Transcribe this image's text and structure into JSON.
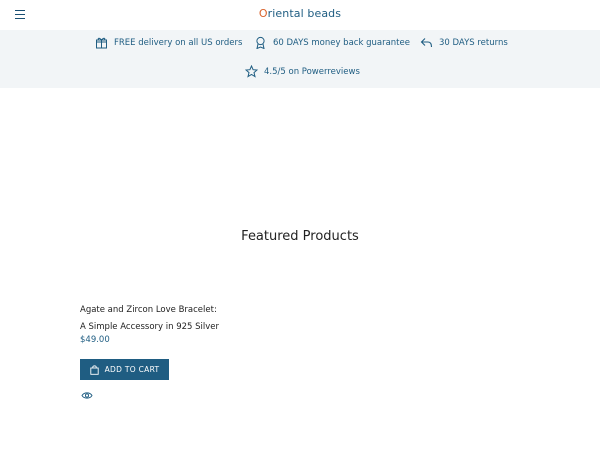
{
  "header": {
    "logo_first": "O",
    "logo_rest": "riental beads",
    "menu_icon": "hamburger-menu-icon"
  },
  "benefits": [
    {
      "icon": "gift-box-icon",
      "text": "FREE delivery on all US orders"
    },
    {
      "icon": "award-ribbon-icon",
      "text": "60 DAYS money back guarantee"
    },
    {
      "icon": "return-arrow-icon",
      "text": "30 DAYS returns"
    },
    {
      "icon": "star-icon",
      "text": "4.5/5 on Powerreviews"
    }
  ],
  "featured": {
    "title": "Featured Products"
  },
  "product": {
    "title_line1": "Agate and Zircon Love Bracelet:",
    "title_line2": "A Simple Accessory in 925 Silver",
    "price": "$49.00",
    "add_to_cart": "ADD TO CART",
    "quick_view_icon": "eye-icon"
  },
  "colors": {
    "brand_blue": "#1f5d82",
    "brand_orange": "#d9622b",
    "benefit_bar": "#f2f5f7"
  }
}
